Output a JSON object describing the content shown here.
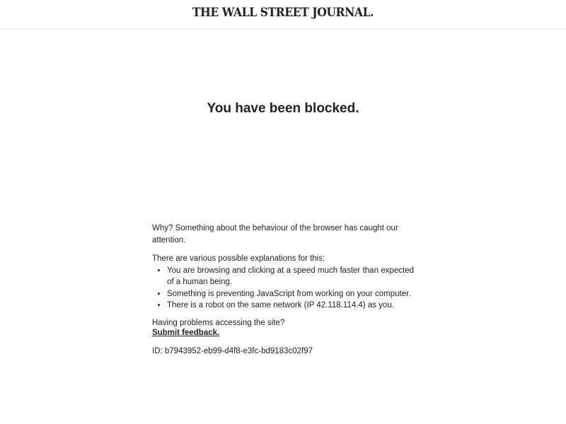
{
  "header": {
    "logo_text": "THE WALL STREET JOURNAL."
  },
  "main": {
    "title": "You have been blocked.",
    "why_text": "Why? Something about the behaviour of the browser has caught our attention.",
    "explanations_intro": "There are various possible explanations for this:",
    "reasons": [
      "You are browsing and clicking at a speed much faster than expected of a human being.",
      "Something is preventing JavaScript from working on your computer.",
      "There is a robot on the same network (IP 42.118.114.4) as you."
    ],
    "problems_text": "Having problems accessing the site?",
    "feedback_link": "Submit feedback.",
    "id_text": "ID: b7943952-eb99-d4f8-e3fc-bd9183c02f97"
  }
}
